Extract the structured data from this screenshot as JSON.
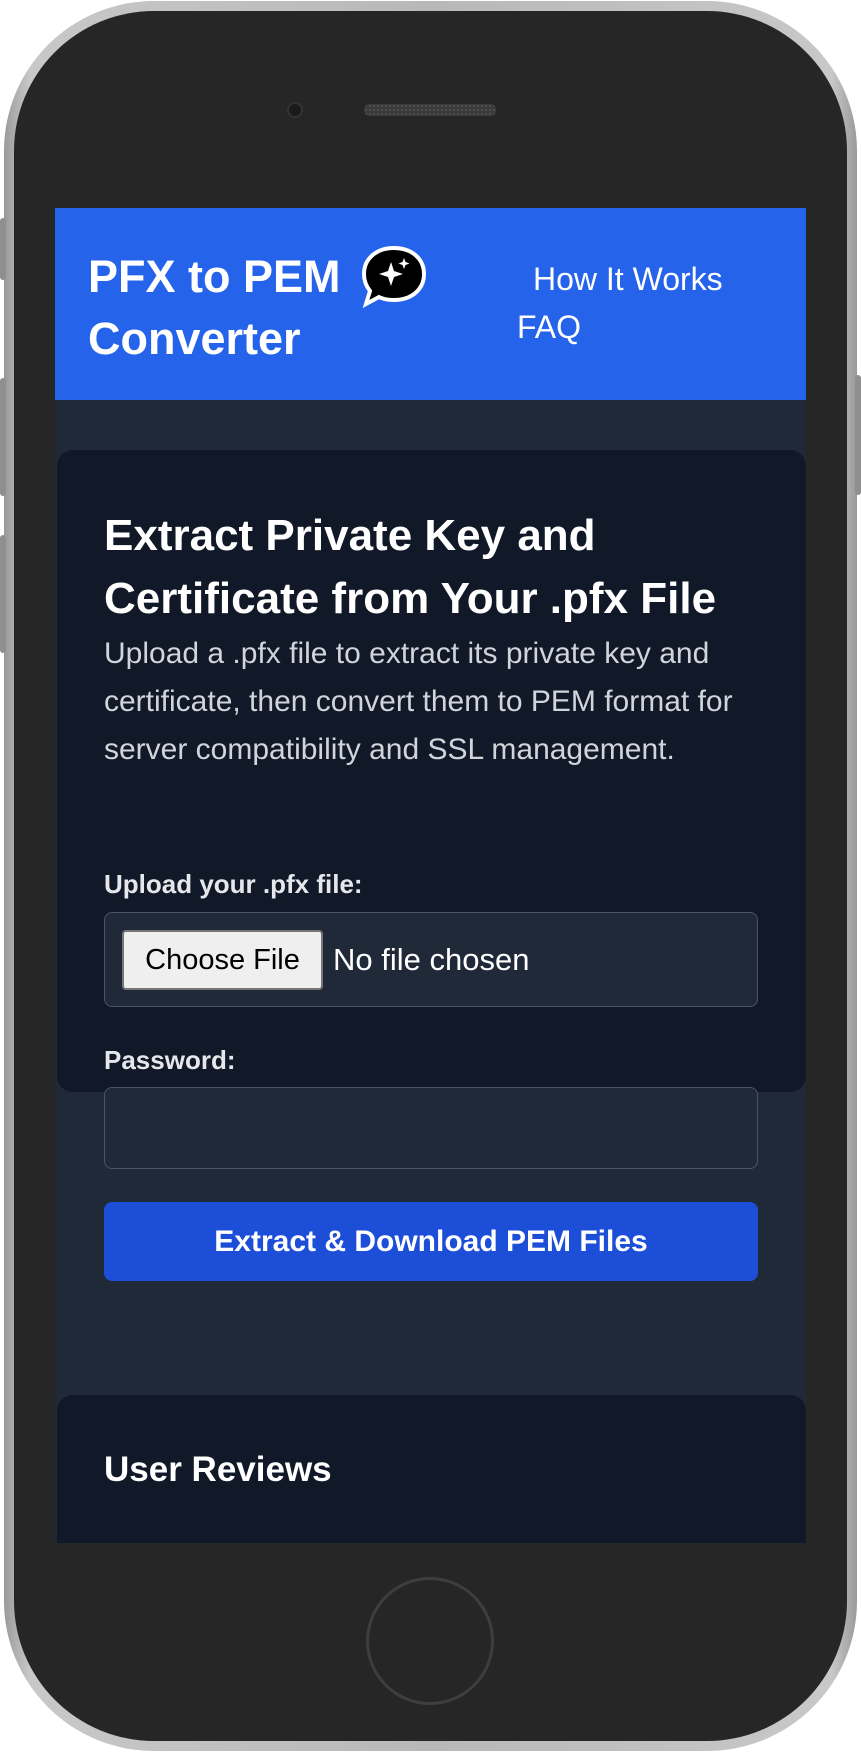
{
  "header": {
    "logo_title": "PFX to PEM Converter",
    "nav": {
      "how_it_works": "How It Works",
      "faq": "FAQ"
    },
    "chat_icon": "sparkle-chat-icon"
  },
  "converter": {
    "title": "Extract Private Key and Certificate from Your .pfx File",
    "description": "Upload a .pfx file to extract its private key and certificate, then convert them to PEM format for server compatibility and SSL management.",
    "file_label": "Upload your .pfx file:",
    "choose_file_label": "Choose File",
    "no_file_text": "No file chosen",
    "password_label": "Password:",
    "password_value": "",
    "submit_label": "Extract & Download PEM Files"
  },
  "reviews": {
    "title": "User Reviews"
  },
  "colors": {
    "header_bg": "#2563eb",
    "card_bg": "#111827",
    "page_bg": "#1f2937",
    "button_bg": "#1d4ed8"
  }
}
